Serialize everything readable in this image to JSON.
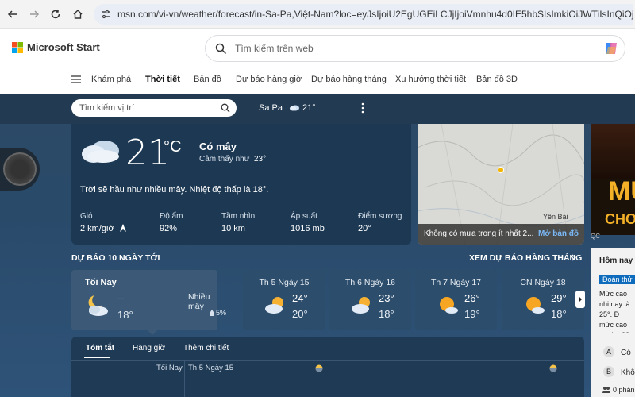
{
  "browser": {
    "url": "msn.com/vi-vn/weather/forecast/in-Sa-Pa,Việt-Nam?loc=eyJsIjoiU2EgUGEiLCJjIjoiVmnhu4d0IE5hbSIsImkiOiJWTiIsInQiOjEwMiwiZyI6InZp"
  },
  "header": {
    "logo": "Microsoft Start",
    "search_placeholder": "Tìm kiếm trên web"
  },
  "nav": {
    "items": [
      "Khám phá",
      "Thời tiết",
      "Bản đồ",
      "Dự báo hàng giờ",
      "Dự báo hàng tháng",
      "Xu hướng thời tiết",
      "Bản đồ 3D"
    ]
  },
  "weather_bar": {
    "search_placeholder": "Tìm kiếm vị trí",
    "location": "Sa Pa",
    "temp": "21°"
  },
  "current": {
    "temp": "21",
    "unit": "°C",
    "condition": "Có mây",
    "feels_label": "Cảm thấy như",
    "feels": "23°",
    "summary": "Trời sẽ hầu như nhiều mây. Nhiệt độ thấp là 18°.",
    "stats": [
      {
        "label": "Gió",
        "value": "2 km/giờ"
      },
      {
        "label": "Độ ẩm",
        "value": "92%"
      },
      {
        "label": "Tầm nhìn",
        "value": "10 km"
      },
      {
        "label": "Áp suất",
        "value": "1016 mb"
      },
      {
        "label": "Điểm sương",
        "value": "20°"
      }
    ]
  },
  "map": {
    "caption": "Không có mưa trong ít nhất 2...",
    "link": "Mở bản đồ",
    "city": "Yên Bái"
  },
  "ad": {
    "text1": "MU",
    "text2": "CHƠ",
    "tag": "QC"
  },
  "forecast": {
    "title": "DỰ BÁO 10 NGÀY TỚI",
    "monthly_link": "XEM DỰ BÁO HÀNG THÁNG",
    "today": {
      "label": "Tối Nay",
      "hi": "--",
      "lo": "18°",
      "cond": "Nhiều mây",
      "rain": "5%"
    },
    "days": [
      {
        "day": "Th 5 Ngày 15",
        "hi": "24°",
        "lo": "20°"
      },
      {
        "day": "Th 6 Ngày 16",
        "hi": "23°",
        "lo": "18°"
      },
      {
        "day": "Th 7 Ngày 17",
        "hi": "26°",
        "lo": "19°"
      },
      {
        "day": "CN Ngày 18",
        "hi": "29°",
        "lo": "18°"
      }
    ]
  },
  "tabs": [
    "Tóm tắt",
    "Hàng giờ",
    "Thêm chi tiết"
  ],
  "timeline": {
    "label1": "Tối Nay",
    "label2": "Th 5 Ngày 15"
  },
  "side": {
    "question": "Hôm nay s",
    "badge": "Đoán thử",
    "text": "Mức cao nhi nay là 25°. Đ mức cao tru thg 2?",
    "options": [
      {
        "key": "A",
        "label": "Có"
      },
      {
        "key": "B",
        "label": "Khô"
      }
    ],
    "count": "0 phản"
  },
  "colors": {
    "accent": "#0f6cbd",
    "bg": "#2a4a6a"
  }
}
